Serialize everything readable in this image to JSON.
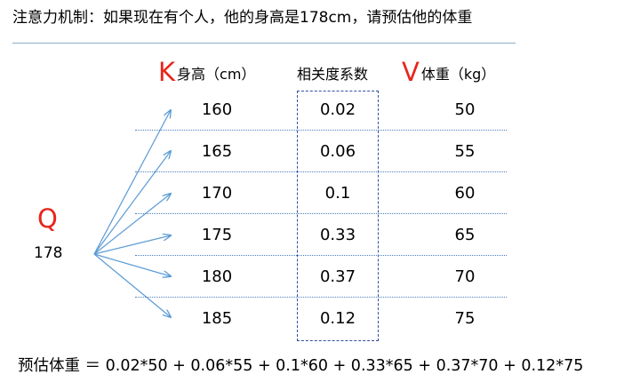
{
  "title": "注意力机制：如果现在有个人，他的身高是178cm，请预估他的体重",
  "headers": {
    "k_letter": "K",
    "k_label": "身高（cm）",
    "weight_label": "相关度系数",
    "v_letter": "V",
    "v_label": "体重（kg）"
  },
  "query": {
    "letter": "Q",
    "value": "178"
  },
  "rows": [
    {
      "height": "160",
      "weight": "0.02",
      "value": "50"
    },
    {
      "height": "165",
      "weight": "0.06",
      "value": "55"
    },
    {
      "height": "170",
      "weight": "0.1",
      "value": "60"
    },
    {
      "height": "175",
      "weight": "0.33",
      "value": "65"
    },
    {
      "height": "180",
      "weight": "0.37",
      "value": "70"
    },
    {
      "height": "185",
      "weight": "0.12",
      "value": "75"
    }
  ],
  "formula": "预估体重 ＝ 0.02*50 + 0.06*55 + 0.1*60 + 0.33*65 + 0.37*70 + 0.12*75",
  "colors": {
    "accent": "#e8251c",
    "arrow": "#5b9bd5",
    "line": "#4f7fbf",
    "box": "#2f4f9f"
  }
}
